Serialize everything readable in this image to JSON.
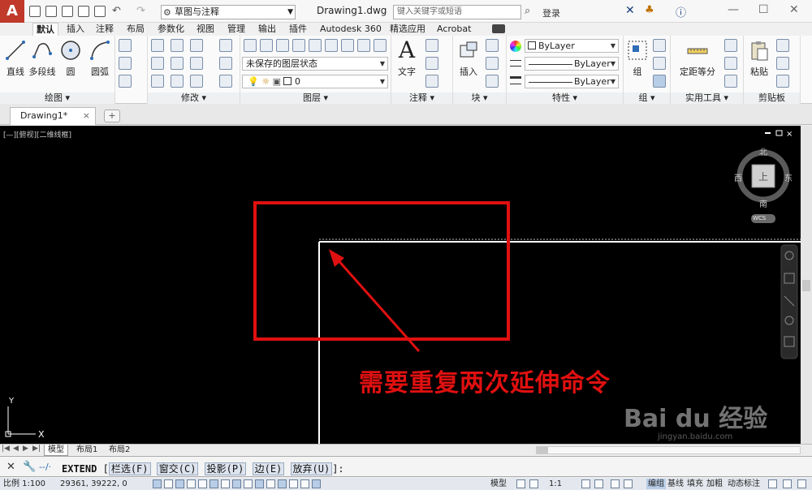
{
  "titlebar": {
    "workspace": "草图与注释",
    "doc_title": "Drawing1.dwg",
    "search_placeholder": "键入关键字或短语",
    "login": "登录"
  },
  "ribbon_tabs": [
    "默认",
    "插入",
    "注释",
    "布局",
    "参数化",
    "视图",
    "管理",
    "输出",
    "插件",
    "Autodesk 360",
    "精选应用",
    "Acrobat"
  ],
  "active_tab": "默认",
  "panels": {
    "draw": {
      "title": "绘图",
      "tools": [
        "直线",
        "多段线",
        "圆",
        "圆弧"
      ]
    },
    "modify": {
      "title": "修改"
    },
    "layers": {
      "title": "图层",
      "layer_state": "未保存的图层状态",
      "current_layer": "0"
    },
    "annotation": {
      "title": "注释",
      "tools": [
        "文字"
      ]
    },
    "block": {
      "title": "块",
      "tools": [
        "插入"
      ]
    },
    "properties": {
      "title": "特性",
      "color": "ByLayer",
      "linetype": "ByLayer",
      "lineweight": "ByLayer"
    },
    "groups": {
      "title": "组",
      "tools": [
        "组"
      ]
    },
    "utilities": {
      "title": "实用工具",
      "tools": [
        "定距等分"
      ]
    },
    "clipboard": {
      "title": "剪贴板",
      "tools": [
        "粘贴"
      ]
    }
  },
  "doc_tabs": [
    {
      "label": "Drawing1*"
    }
  ],
  "viewport": {
    "label": "[—][俯视][二维线框]",
    "viewcube": {
      "north": "北",
      "south": "南",
      "east": "东",
      "west": "西",
      "top": "上",
      "wcs": "WCS"
    },
    "annotation": "需要重复两次延伸命令"
  },
  "layout_tabs": [
    "模型",
    "布局1",
    "布局2"
  ],
  "command": {
    "name": "EXTEND",
    "options": [
      "栏选(F)",
      "窗交(C)",
      "投影(P)",
      "边(E)",
      "放弃(U)"
    ],
    "open": "[",
    "close": "]:"
  },
  "status": {
    "scale": "比例 1:100",
    "coords": "29361, 39222, 0",
    "model": "模型",
    "anno_scale": "1:1",
    "right_items": [
      "编组",
      "基线",
      "填充",
      "加粗",
      "动态标注"
    ]
  },
  "watermark": {
    "text": "Bai du 经验",
    "sub": "jingyan.baidu.com"
  },
  "colors": {
    "canvas": "#000000",
    "highlight": "#e01010",
    "accent": "#c0392b"
  }
}
